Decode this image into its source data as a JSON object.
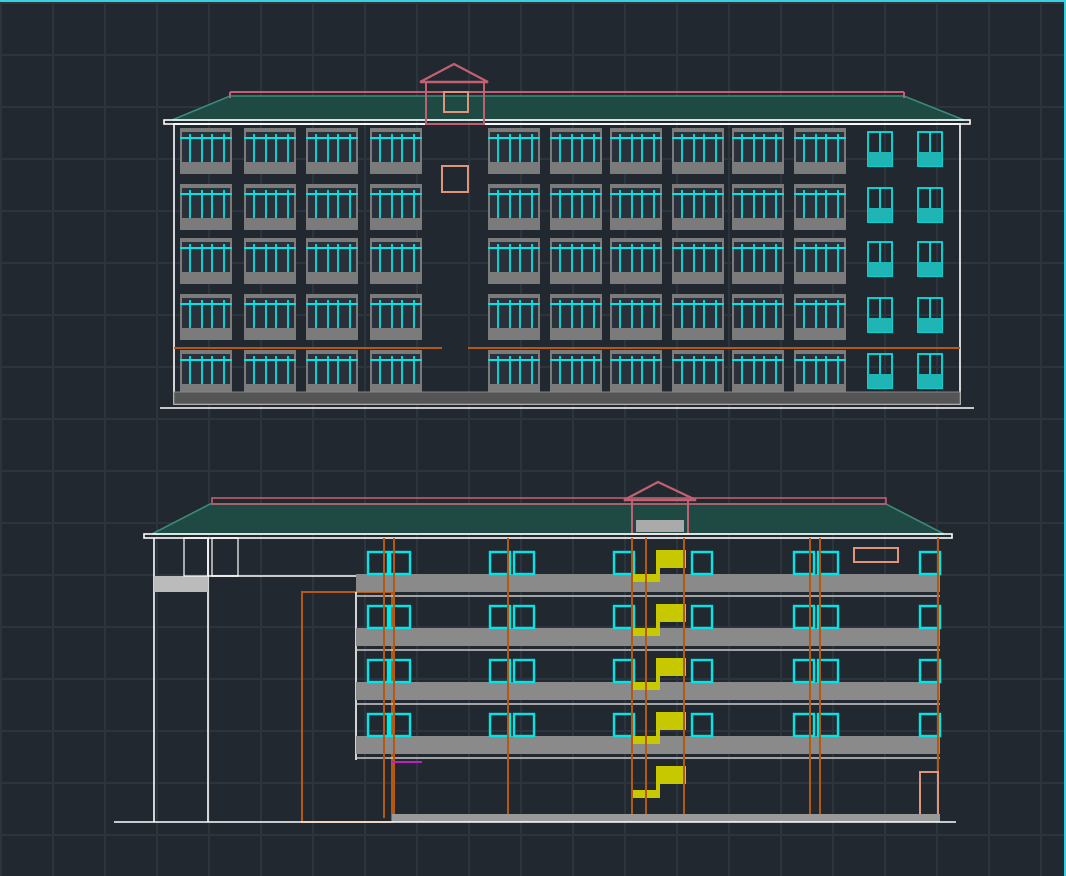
{
  "viewport": {
    "drawings": [
      {
        "kind": "front-elevation"
      },
      {
        "kind": "rear-elevation"
      }
    ]
  }
}
